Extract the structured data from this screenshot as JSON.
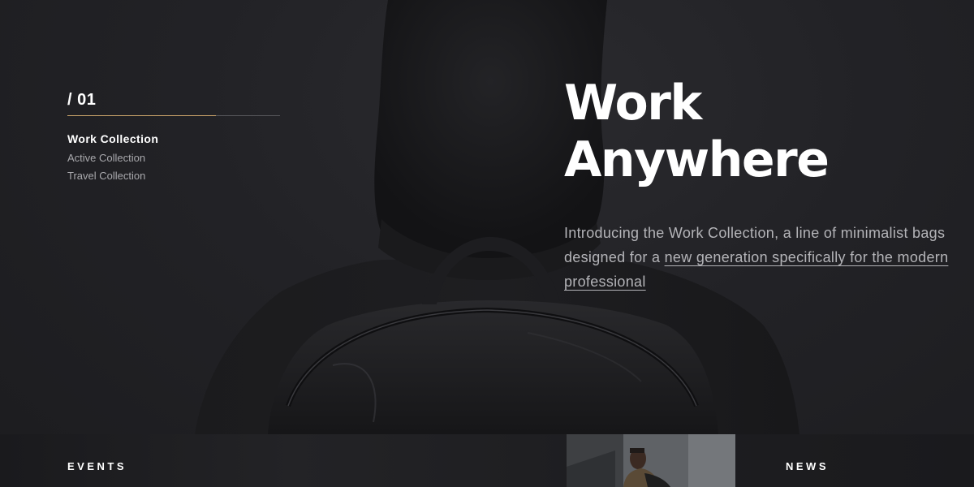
{
  "nav": {
    "slide_index": "/ 01",
    "progress": 0.7,
    "items": [
      {
        "label": "Work Collection",
        "active": true
      },
      {
        "label": "Active Collection",
        "active": false
      },
      {
        "label": "Travel Collection",
        "active": false
      }
    ]
  },
  "hero": {
    "title_line1": "Work",
    "title_line2": "Anywhere",
    "desc_plain": "Introducing the Work Collection, a line of minimalist bags designed for a ",
    "desc_link": "new generation specifically for the modern professional"
  },
  "footer": {
    "events_label": "EVENTS",
    "news_label": "NEWS"
  },
  "colors": {
    "background": "#1f1f22",
    "accent": "#c9a36a",
    "text_primary": "#ffffff",
    "text_secondary": "#b4b4b8"
  }
}
